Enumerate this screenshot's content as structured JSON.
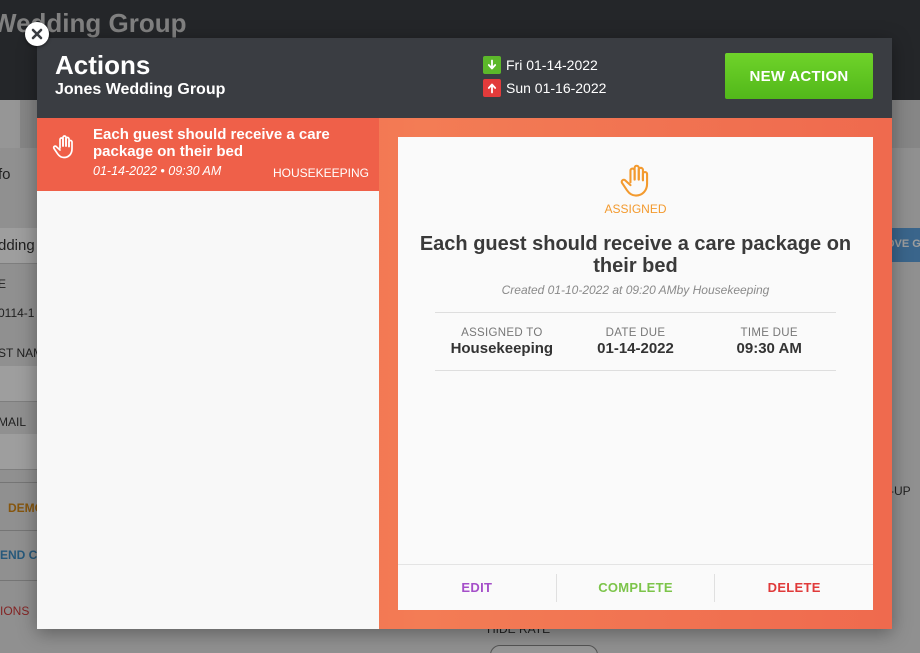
{
  "background": {
    "page_title": "Wedding Group",
    "labels": [
      "fo",
      "dding",
      "E",
      "0114-1",
      "ST NAM",
      "MAIL",
      "DEMO",
      "END CO",
      "IONS",
      "OVE G",
      "-UP",
      "HIDE RATE"
    ]
  },
  "modal": {
    "title": "Actions",
    "subtitle": "Jones Wedding Group",
    "arrival_date": "Fri 01-14-2022",
    "departure_date": "Sun 01-16-2022",
    "new_action_label": "NEW ACTION",
    "colors": {
      "header": "#3a3d42",
      "accent": "#f05e4b",
      "green": "#5cc21f",
      "red": "#e23b3b"
    }
  },
  "list": {
    "items": [
      {
        "title": "Each guest should receive a care package on their bed",
        "date_time": "01-14-2022 • 09:30 AM",
        "department": "HOUSEKEEPING",
        "icon": "hand-icon"
      }
    ]
  },
  "detail": {
    "status": "ASSIGNED",
    "title": "Each guest should receive a care package on their bed",
    "created": "Created 01-10-2022 at 09:20 AMby Housekeeping",
    "assigned_to_label": "ASSIGNED TO",
    "assigned_to": "Housekeeping",
    "date_due_label": "DATE DUE",
    "date_due": "01-14-2022",
    "time_due_label": "TIME DUE",
    "time_due": "09:30 AM",
    "edit_label": "EDIT",
    "complete_label": "COMPLETE",
    "delete_label": "DELETE",
    "colors": {
      "status": "#f39a2e",
      "edit": "#a54fc9",
      "complete": "#7cc44a",
      "delete": "#e03a3a"
    }
  }
}
